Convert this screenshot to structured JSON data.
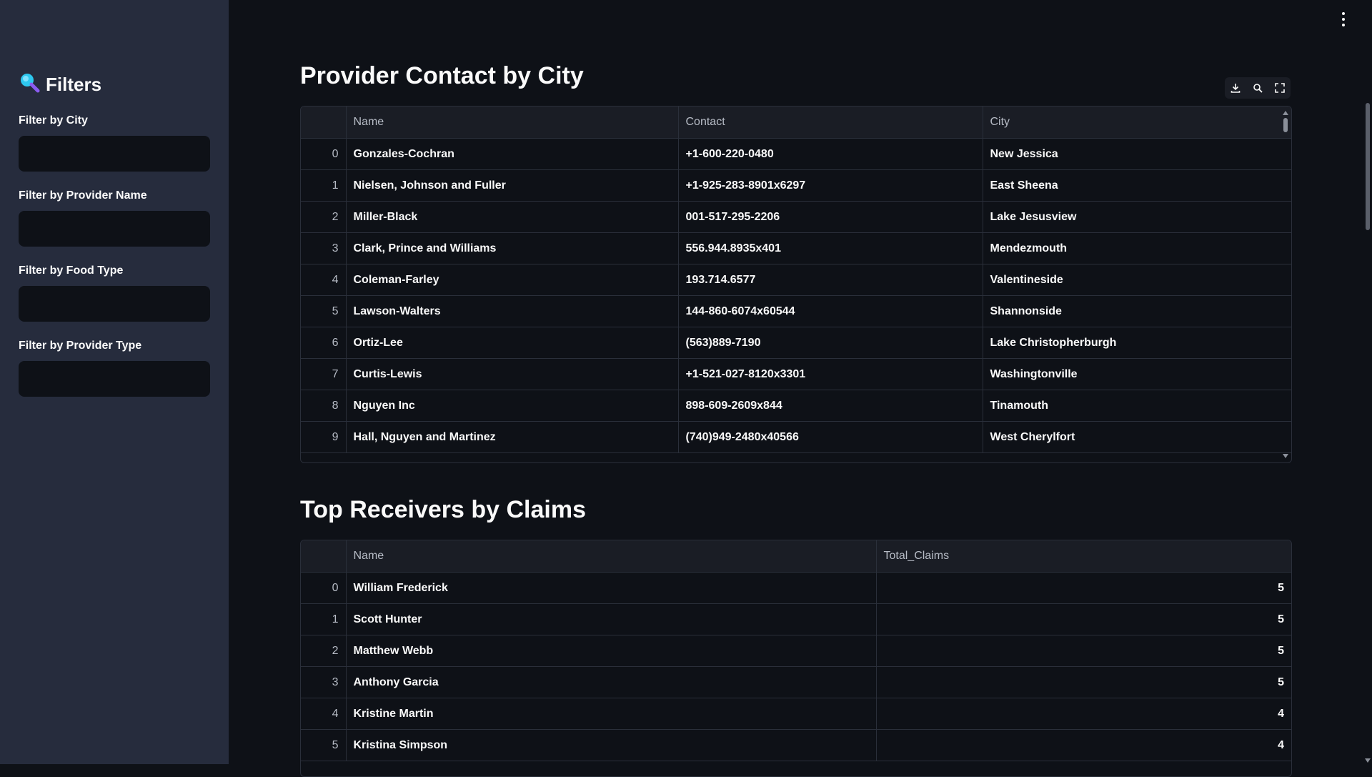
{
  "sidebar": {
    "title": "Filters",
    "filters": [
      {
        "label": "Filter by City",
        "value": ""
      },
      {
        "label": "Filter by Provider Name",
        "value": ""
      },
      {
        "label": "Filter by Food Type",
        "value": ""
      },
      {
        "label": "Filter by Provider Type",
        "value": ""
      }
    ]
  },
  "provider_section": {
    "title": "Provider Contact by City",
    "columns": [
      "Name",
      "Contact",
      "City"
    ],
    "rows": [
      {
        "idx": "0",
        "name": "Gonzales-Cochran",
        "contact": "+1-600-220-0480",
        "city": "New Jessica"
      },
      {
        "idx": "1",
        "name": "Nielsen, Johnson and Fuller",
        "contact": "+1-925-283-8901x6297",
        "city": "East Sheena"
      },
      {
        "idx": "2",
        "name": "Miller-Black",
        "contact": "001-517-295-2206",
        "city": "Lake Jesusview"
      },
      {
        "idx": "3",
        "name": "Clark, Prince and Williams",
        "contact": "556.944.8935x401",
        "city": "Mendezmouth"
      },
      {
        "idx": "4",
        "name": "Coleman-Farley",
        "contact": "193.714.6577",
        "city": "Valentineside"
      },
      {
        "idx": "5",
        "name": "Lawson-Walters",
        "contact": "144-860-6074x60544",
        "city": "Shannonside"
      },
      {
        "idx": "6",
        "name": "Ortiz-Lee",
        "contact": "(563)889-7190",
        "city": "Lake Christopherburgh"
      },
      {
        "idx": "7",
        "name": "Curtis-Lewis",
        "contact": "+1-521-027-8120x3301",
        "city": "Washingtonville"
      },
      {
        "idx": "8",
        "name": "Nguyen Inc",
        "contact": "898-609-2609x844",
        "city": "Tinamouth"
      },
      {
        "idx": "9",
        "name": "Hall, Nguyen and Martinez",
        "contact": "(740)949-2480x40566",
        "city": "West Cherylfort"
      }
    ],
    "toolbar": [
      "download-icon",
      "search-icon",
      "fullscreen-icon"
    ]
  },
  "receivers_section": {
    "title": "Top Receivers by Claims",
    "columns": [
      "Name",
      "Total_Claims"
    ],
    "rows": [
      {
        "idx": "0",
        "name": "William Frederick",
        "total": "5"
      },
      {
        "idx": "1",
        "name": "Scott Hunter",
        "total": "5"
      },
      {
        "idx": "2",
        "name": "Matthew Webb",
        "total": "5"
      },
      {
        "idx": "3",
        "name": "Anthony Garcia",
        "total": "5"
      },
      {
        "idx": "4",
        "name": "Kristine Martin",
        "total": "4"
      },
      {
        "idx": "5",
        "name": "Kristina Simpson",
        "total": "4"
      }
    ]
  },
  "colors": {
    "background": "#0e1117",
    "sidebar": "#262c3d",
    "accent_icon": "#2dc8f0"
  }
}
